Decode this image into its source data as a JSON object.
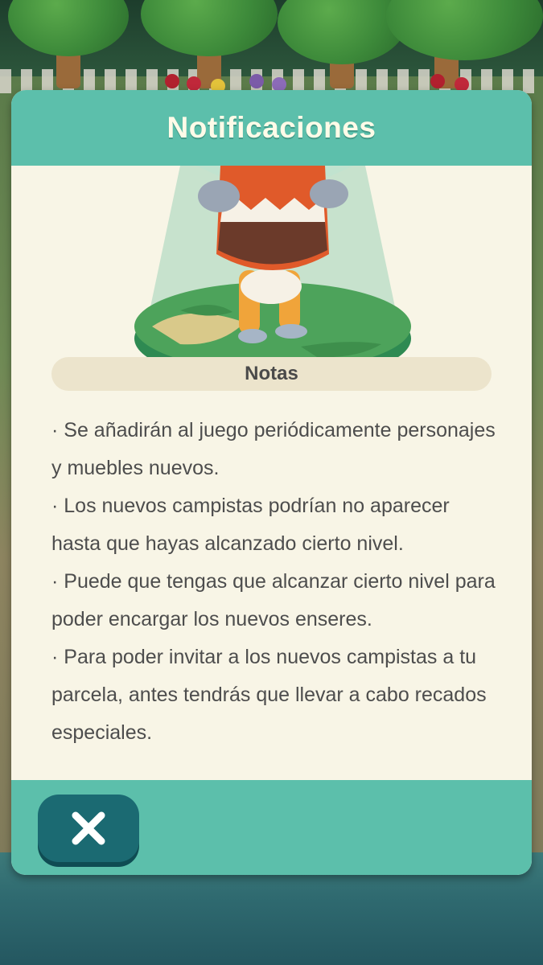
{
  "dialog": {
    "title": "Notificaciones",
    "notes_label": "Notas",
    "notes": [
      "· Se añadirán al juego periódicamente personajes y muebles nuevos.",
      "· Los nuevos campistas podrían no aparecer hasta que hayas alcanzado cierto nivel.",
      "· Puede que tengas que alcanzar cierto nivel para poder encargar los nuevos enseres.",
      "· Para poder invitar a los nuevos campistas a tu parcela, antes tendrás que llevar a cabo recados especiales."
    ],
    "close_icon": "close-icon"
  },
  "colors": {
    "header": "#5cbfab",
    "panel": "#f8f5e6",
    "pill": "#ece4cc",
    "close_button": "#1b6a72",
    "text": "#4d4d4d"
  }
}
